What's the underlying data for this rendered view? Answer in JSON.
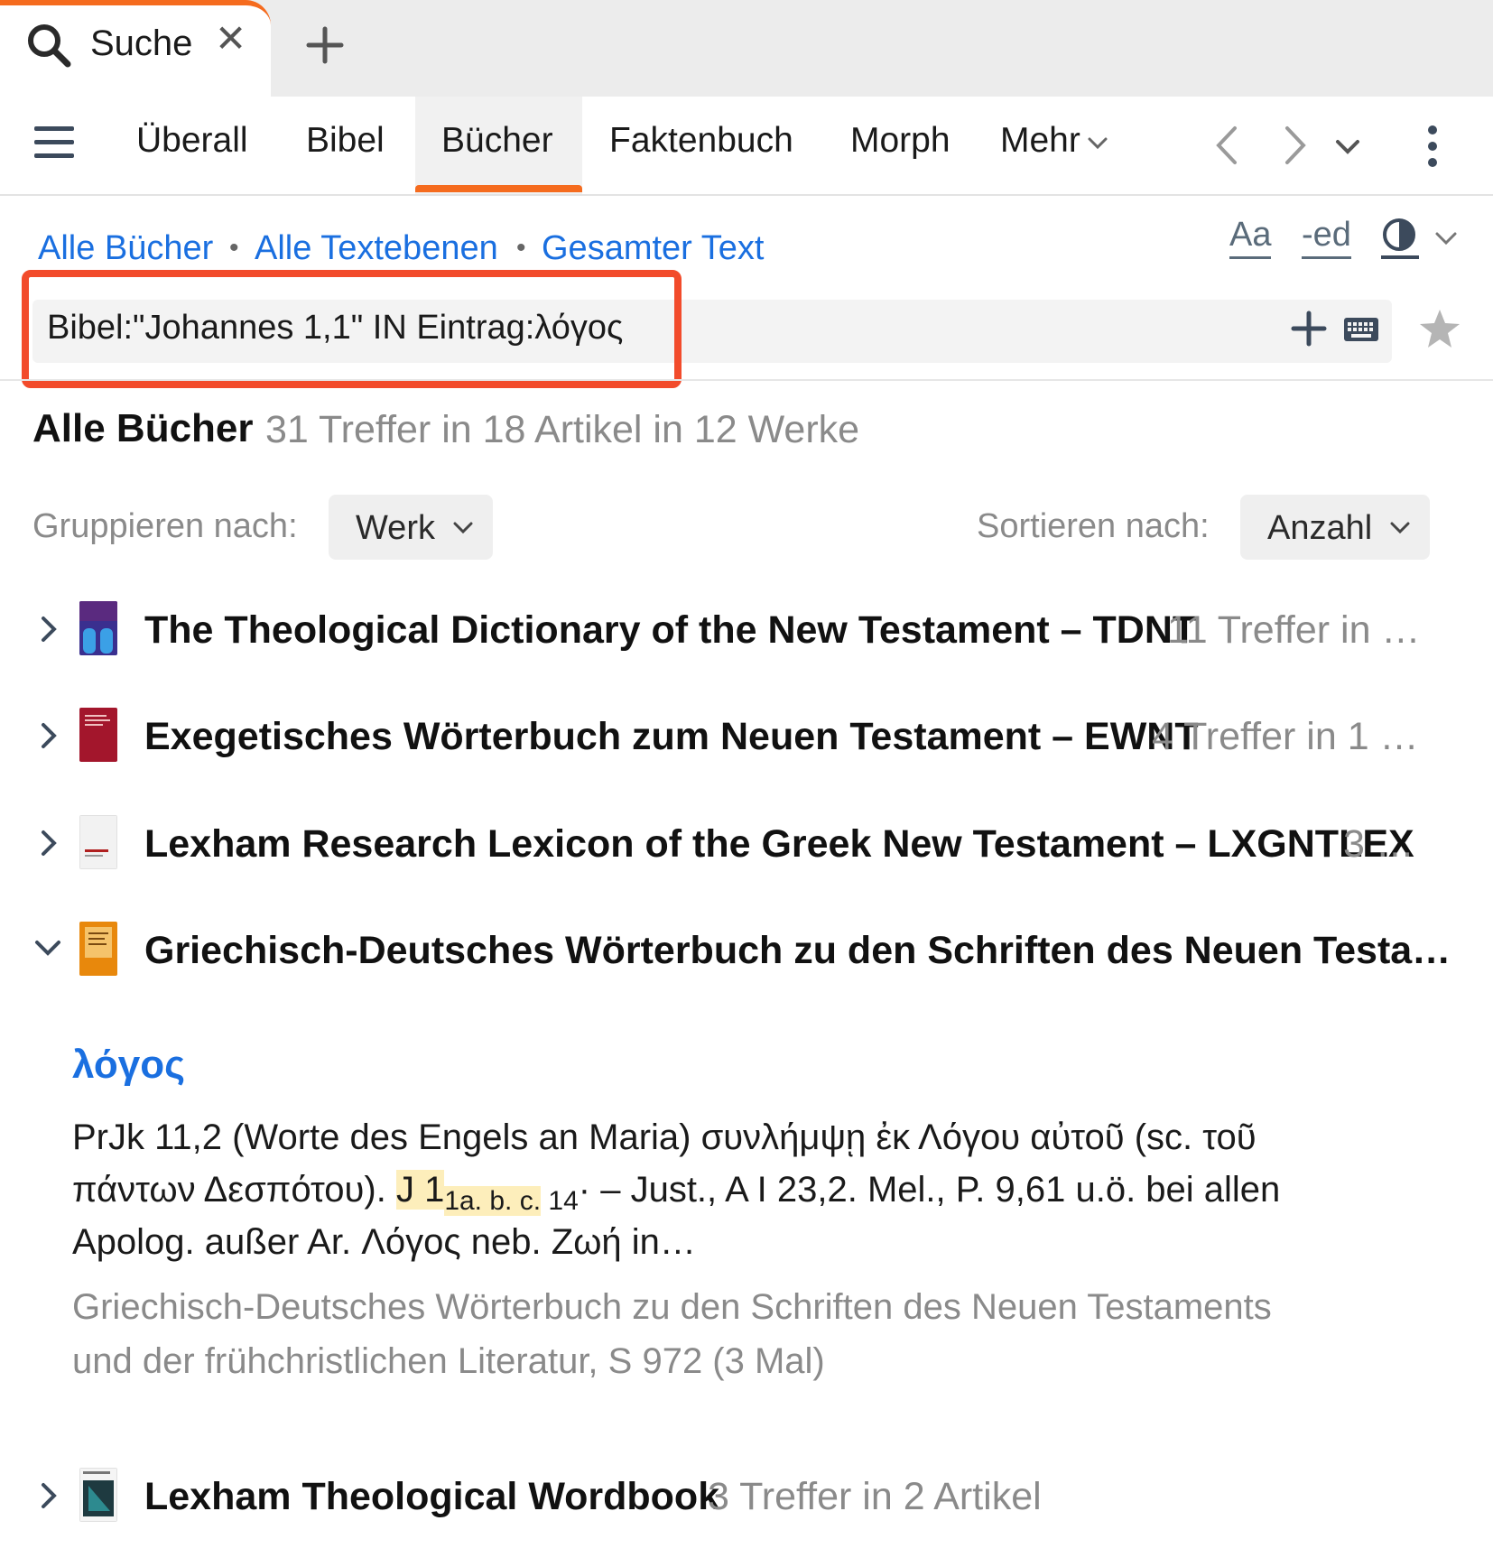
{
  "tabs": {
    "active_label": "Suche",
    "close_glyph": "✕",
    "add_icon": "plus-icon"
  },
  "nav": {
    "items": [
      "Überall",
      "Bibel",
      "Bücher",
      "Faktenbuch",
      "Morph",
      "Mehr"
    ],
    "active": "Bücher"
  },
  "breadcrumb": {
    "items": [
      "Alle Bücher",
      "Alle Textebenen",
      "Gesamter Text"
    ],
    "separator": "•"
  },
  "tools": {
    "font_label": "Aa",
    "ed_label": "-ed"
  },
  "search": {
    "query": "Bibel:\"Johannes 1,1\" IN Eintrag:λόγος"
  },
  "heading": {
    "title": "Alle Bücher",
    "summary": "31 Treffer in 18 Artikel in 12 Werke"
  },
  "controls": {
    "group_label": "Gruppieren nach:",
    "group_value": "Werk",
    "sort_label": "Sortieren nach:",
    "sort_value": "Anzahl"
  },
  "results": [
    {
      "title": "The Theological Dictionary of the New Testament – TDNT",
      "meta": "11 Treffer in …",
      "expanded": false,
      "cover_color": "#3a2f8f"
    },
    {
      "title": "Exegetisches Wörterbuch zum Neuen Testament – EWNT",
      "meta": "4 Treffer in 1 …",
      "expanded": false,
      "cover_color": "#a3162c"
    },
    {
      "title": "Lexham Research Lexicon of the Greek New Testament – LXGNTLEX",
      "meta": "3 …",
      "expanded": false,
      "cover_color": "#f2f2f2"
    },
    {
      "title": "Griechisch-Deutsches Wörterbuch zu den Schriften des Neuen Testa…",
      "meta": "",
      "expanded": true,
      "cover_color": "#e8880c"
    },
    {
      "title": "Lexham Theological Wordbook",
      "meta": "3 Treffer in 2 Artikel",
      "expanded": false,
      "cover_color": "#1e3a40"
    }
  ],
  "article": {
    "headword": "λόγος",
    "line1": "PrJk 11,2 (Worte des Engels an Maria) συνλήμψῃ ἐκ Λόγου αὐτοῦ (sc. τοῦ",
    "line2_pre": "πάντων Δεσπότου). ",
    "line2_hl1": "J 1",
    "line2_sub1": "1a.",
    "line2_sub2": " b.",
    "line2_sub3": " c.",
    "line2_sub4": " 14",
    "line2_post": "· – Just., A I 23,2. Mel., P. 9,61 u.ö. bei allen",
    "line3": "Apolog. außer Ar. Λόγος neb. Ζωή in…",
    "source1": "Griechisch-Deutsches Wörterbuch zu den Schriften des Neuen Testaments",
    "source2": "und der frühchristlichen Literatur, S 972 (3 Mal)"
  },
  "colors": {
    "accent_orange": "#f56b1e",
    "link_blue": "#1a6fe0",
    "highlight_red": "#f24b2b",
    "hit_highlight": "#fdeebb"
  }
}
